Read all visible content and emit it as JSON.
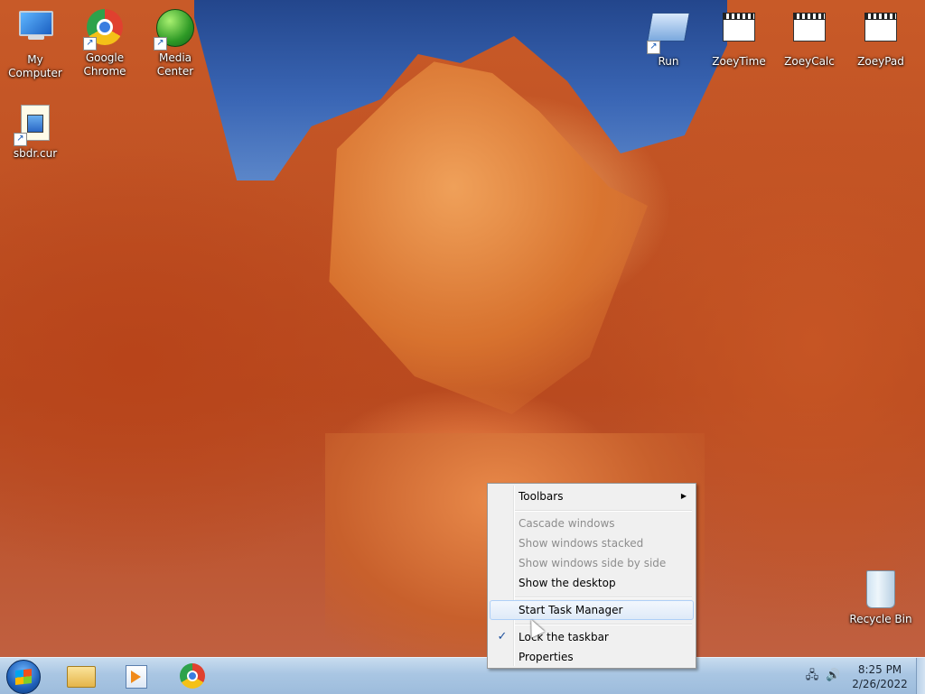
{
  "desktop": {
    "icons": [
      {
        "label": "My Computer",
        "icon": "computer-icon"
      },
      {
        "label": "Google Chrome",
        "icon": "chrome-icon"
      },
      {
        "label": "Media Center",
        "icon": "media-center-icon"
      },
      {
        "label": "sbdr.cur",
        "icon": "cursor-file-icon"
      },
      {
        "label": "Run",
        "icon": "run-icon"
      },
      {
        "label": "ZoeyTime",
        "icon": "film-icon"
      },
      {
        "label": "ZoeyCalc",
        "icon": "film-icon"
      },
      {
        "label": "ZoeyPad",
        "icon": "film-icon"
      },
      {
        "label": "Recycle Bin",
        "icon": "recycle-bin-icon"
      }
    ]
  },
  "context_menu": {
    "items": [
      {
        "label": "Toolbars",
        "enabled": true,
        "submenu": true
      },
      {
        "label": "Cascade windows",
        "enabled": false
      },
      {
        "label": "Show windows stacked",
        "enabled": false
      },
      {
        "label": "Show windows side by side",
        "enabled": false
      },
      {
        "label": "Show the desktop",
        "enabled": true
      },
      {
        "label": "Start Task Manager",
        "enabled": true,
        "highlighted": true
      },
      {
        "label": "Lock the taskbar",
        "enabled": true,
        "checked": true
      },
      {
        "label": "Properties",
        "enabled": true
      }
    ],
    "submenu_arrow": "▶",
    "checkmark": "✓"
  },
  "taskbar": {
    "pinned": [
      "windows-explorer-icon",
      "media-player-icon",
      "chrome-icon"
    ],
    "tray": {
      "icons": [
        "network-icon",
        "volume-icon"
      ],
      "time": "8:25 PM",
      "date": "2/26/2022"
    }
  }
}
